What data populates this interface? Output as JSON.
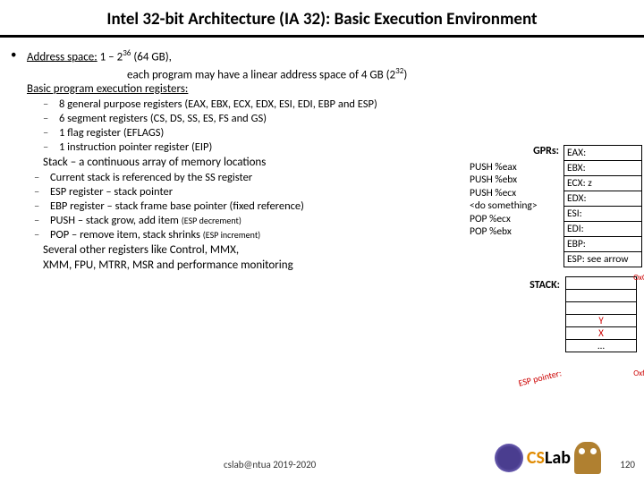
{
  "title": "Intel 32-bit Architecture (IA 32): Basic Execution Environment",
  "addr": {
    "label": "Address space:",
    "range": " 1 – 2",
    "exp1": "36",
    "gb": " (64 GB),",
    "line2a": "each program may have a linear address space of 4 GB (2",
    "exp2": "32",
    "line2b": ")"
  },
  "regs_head": "Basic program execution registers:",
  "sub1": [
    "8 general purpose registers (EAX, EBX, ECX, EDX, ESI, EDI, EBP and ESP)",
    "6 segment registers (CS, DS, SS, ES, FS and GS)",
    "1 flag register (EFLAGS)",
    "1 instruction pointer register (EIP)"
  ],
  "stack_head": "Stack – a continuous array of memory locations",
  "sub2": [
    "Current stack is referenced by the SS register",
    "ESP register – stack pointer",
    "EBP register – stack frame base pointer (fixed reference)"
  ],
  "sub2_push": {
    "a": "PUSH – stack grow, add item ",
    "b": "(ESP decrement)"
  },
  "sub2_pop": {
    "a": "POP – remove item, stack shrinks ",
    "b": "(ESP increment)"
  },
  "other1": "Several other registers like Control, MMX,",
  "other2": "XMM, FPU, MTRR, MSR and performance monitoring",
  "gprs_label": "GPRs:",
  "code": [
    "PUSH %eax",
    "PUSH %ebx",
    "PUSH %ecx",
    "<do something>",
    "POP %ecx",
    "POP %ebx"
  ],
  "gprs": [
    "EAX:",
    "EBX:",
    "ECX:   z",
    "EDX:",
    "ESI:",
    "EDI:",
    "EBP:",
    "ESP: see arrow"
  ],
  "stack_label": "STACK:",
  "stack_rows": [
    "",
    "",
    "",
    "Y",
    "X",
    "…"
  ],
  "oxo": "OxO.",
  "oxff": "Oxfff",
  "esp_ptr": "ESP pointer:",
  "footer": {
    "email": "cslab@ntua 2019-2020",
    "page": "120",
    "cslab_c": "CS",
    "cslab_s": "Lab"
  }
}
